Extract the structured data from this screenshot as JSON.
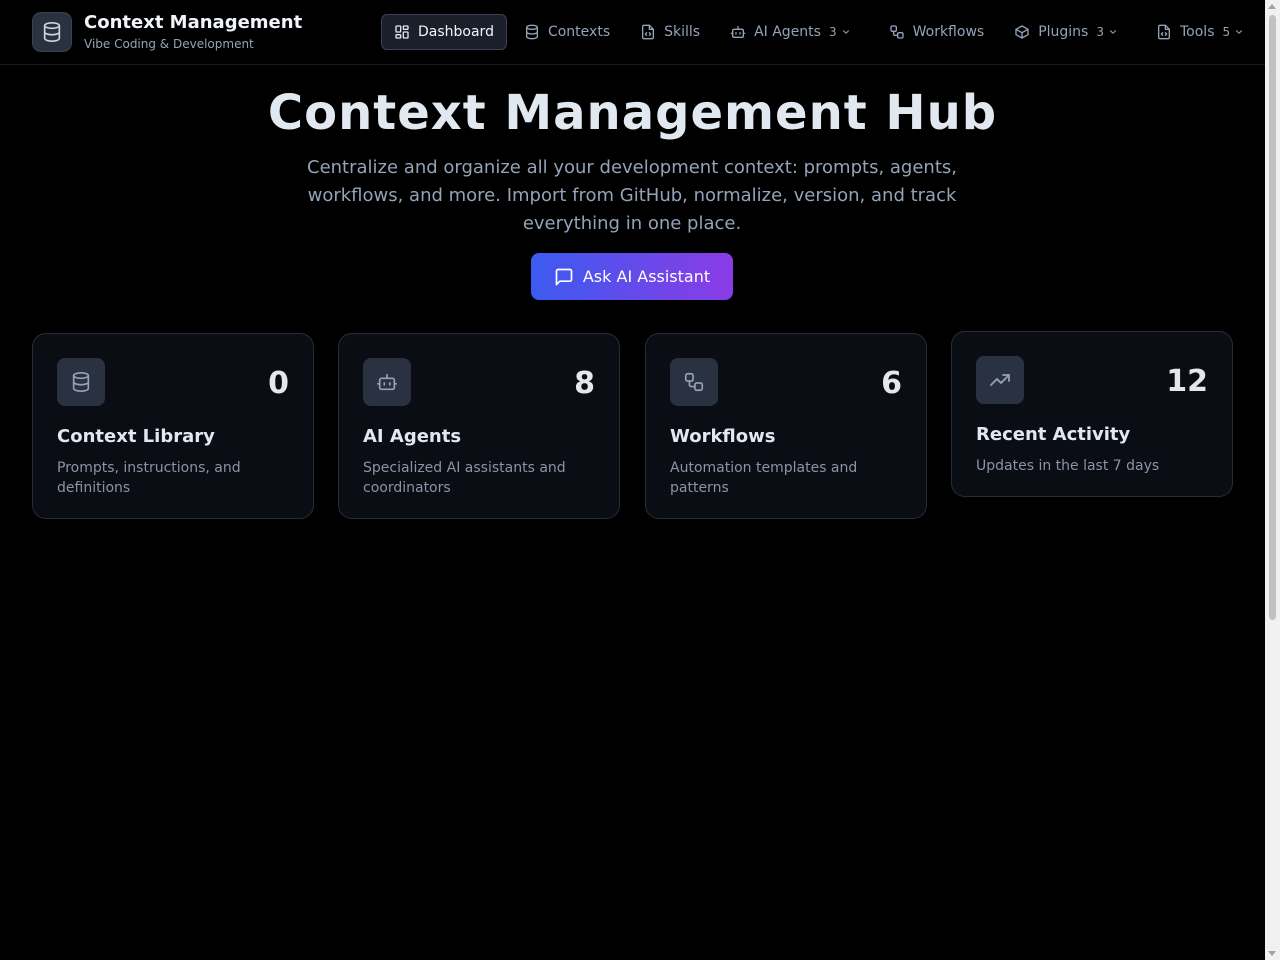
{
  "brand": {
    "title": "Context Management",
    "subtitle": "Vibe Coding & Development",
    "icon": "database-icon"
  },
  "nav": {
    "items": [
      {
        "label": "Dashboard",
        "icon": "dashboard-icon",
        "active": true
      },
      {
        "label": "Contexts",
        "icon": "database-icon"
      },
      {
        "label": "Skills",
        "icon": "file-code-icon"
      },
      {
        "label": "AI Agents",
        "icon": "bot-icon",
        "count": "3",
        "dropdown": true
      },
      {
        "label": "Workflows",
        "icon": "workflow-icon"
      },
      {
        "label": "Plugins",
        "icon": "package-icon",
        "count": "3",
        "dropdown": true
      },
      {
        "label": "Tools",
        "icon": "file-code-icon",
        "count": "5",
        "dropdown": true
      }
    ]
  },
  "hero": {
    "title": "Context Management Hub",
    "description": "Centralize and organize all your development context: prompts, agents, workflows, and more. Import from GitHub, normalize, version, and track everything in one place.",
    "cta_label": "Ask AI Assistant"
  },
  "cards": [
    {
      "title": "Context Library",
      "count": "0",
      "description": "Prompts, instructions, and definitions",
      "icon": "database-icon"
    },
    {
      "title": "AI Agents",
      "count": "8",
      "description": "Specialized AI assistants and coordinators",
      "icon": "bot-icon"
    },
    {
      "title": "Workflows",
      "count": "6",
      "description": "Automation templates and patterns",
      "icon": "workflow-icon"
    },
    {
      "title": "Recent Activity",
      "count": "12",
      "description": "Updates in the last 7 days",
      "icon": "trending-up-icon"
    }
  ],
  "colors": {
    "background": "#000000",
    "card_background": "#0a0d14",
    "accent_start": "#3b5bf0",
    "accent_end": "#8b3be6",
    "muted_text": "#94a3b8"
  }
}
